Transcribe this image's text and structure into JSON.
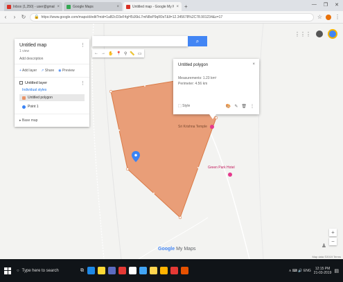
{
  "browser": {
    "tabs": [
      {
        "title": "Inbox (1,250) - user@gmail.com - Gmail",
        "favicon_color": "#d93025",
        "active": false
      },
      {
        "title": "Google Maps",
        "favicon_color": "#34a853",
        "active": false
      },
      {
        "title": "Untitled map - Google My Maps",
        "favicon_color": "#d93025",
        "active": true
      }
    ],
    "url": "https://www.google.com/maps/d/edit?mid=1aB2cD3eF4gH5iJ6kL7mN8oP9qR0sT&ll=12.345678%2C78.901234&z=17",
    "win_controls": [
      "—",
      "❐",
      "✕"
    ]
  },
  "panel": {
    "title": "Untitled map",
    "subtitle": "1 view",
    "description": "Add description",
    "actions": [
      {
        "icon": "+",
        "label": "Add layer"
      },
      {
        "icon": "↗",
        "label": "Share"
      },
      {
        "icon": "◉",
        "label": "Preview"
      }
    ],
    "layer": {
      "name": "Untitled layer",
      "style_link": "Individual styles",
      "items": [
        {
          "label": "Untitled polygon",
          "color": "#e8956a",
          "selected": true
        },
        {
          "label": "Point 1",
          "color": "#3b84f5",
          "selected": false
        }
      ]
    },
    "base_map": "Base map"
  },
  "search": {
    "placeholder": "",
    "button_icon": "⌕"
  },
  "tools": [
    "←",
    "→",
    "✋",
    "📍",
    "⚲",
    "📏",
    "▭"
  ],
  "popup": {
    "title": "Untitled polygon",
    "close": "×",
    "measure": "Measurements: 1.23 km²",
    "perimeter": "Perimeter: 4.56 km",
    "style_label": "Style",
    "icons": [
      "🎨",
      "✎",
      "🗑",
      "⋮"
    ]
  },
  "map": {
    "poi_1": "Sri Krishna Temple",
    "poi_2": "Green Park Hotel",
    "google_logo": "Google",
    "google_logo_suffix": "My Maps",
    "map_data": "Map data ©2019 Terms",
    "zoom_in": "+",
    "zoom_out": "−",
    "pegman": "♟"
  },
  "taskbar": {
    "search_placeholder": "Type here to search",
    "apps": [
      "#1e88e5",
      "#fdd835",
      "#5c6bc0",
      "#e53935",
      "#fff",
      "#42a5f5",
      "#ffd54f",
      "#ffb300",
      "#e53935",
      "#e65100"
    ],
    "time": "12:15 PM",
    "date": "21-03-2019",
    "tray_text": "∧  ⌨  🔊  ENG"
  },
  "colors": {
    "polygon_fill": "#e8956a",
    "polygon_stroke": "#d97a46",
    "accent": "#4285f4",
    "poi_pink": "#e5398d"
  }
}
